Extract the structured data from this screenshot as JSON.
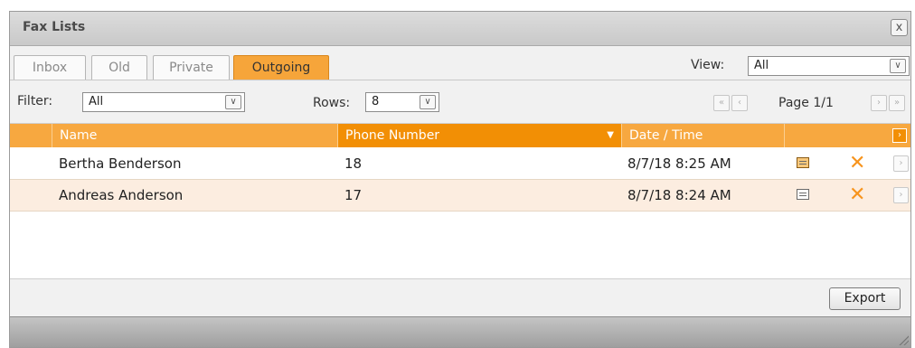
{
  "window": {
    "title": "Fax Lists",
    "close_label": "x"
  },
  "tabs": [
    {
      "label": "Inbox",
      "active": false
    },
    {
      "label": "Old",
      "active": false
    },
    {
      "label": "Private",
      "active": false
    },
    {
      "label": "Outgoing",
      "active": true
    }
  ],
  "view": {
    "label": "View:",
    "value": "All"
  },
  "filter": {
    "label": "Filter:",
    "value": "All"
  },
  "rows_per_page": {
    "label": "Rows:",
    "value": "8"
  },
  "pagination": {
    "text": "Page 1/1"
  },
  "columns": [
    {
      "label": "Name"
    },
    {
      "label": "Phone Number",
      "sorted": true
    },
    {
      "label": "Date / Time"
    }
  ],
  "rows": [
    {
      "name": "Bertha Benderson",
      "phone": "18",
      "datetime": "8/7/18 8:25 AM"
    },
    {
      "name": "Andreas Anderson",
      "phone": "17",
      "datetime": "8/7/18 8:24 AM"
    }
  ],
  "footer": {
    "export_label": "Export"
  },
  "icons": {
    "close": "close-icon",
    "edit": "fax-document-icon",
    "delete": "delete-x-icon",
    "open": "chevron-right-icon",
    "resize": "resize-grip-icon"
  },
  "colors": {
    "accent": "#f7a840",
    "accent_dark": "#f28f05",
    "delete": "#f7941d",
    "row_alt": "#fcede0"
  }
}
